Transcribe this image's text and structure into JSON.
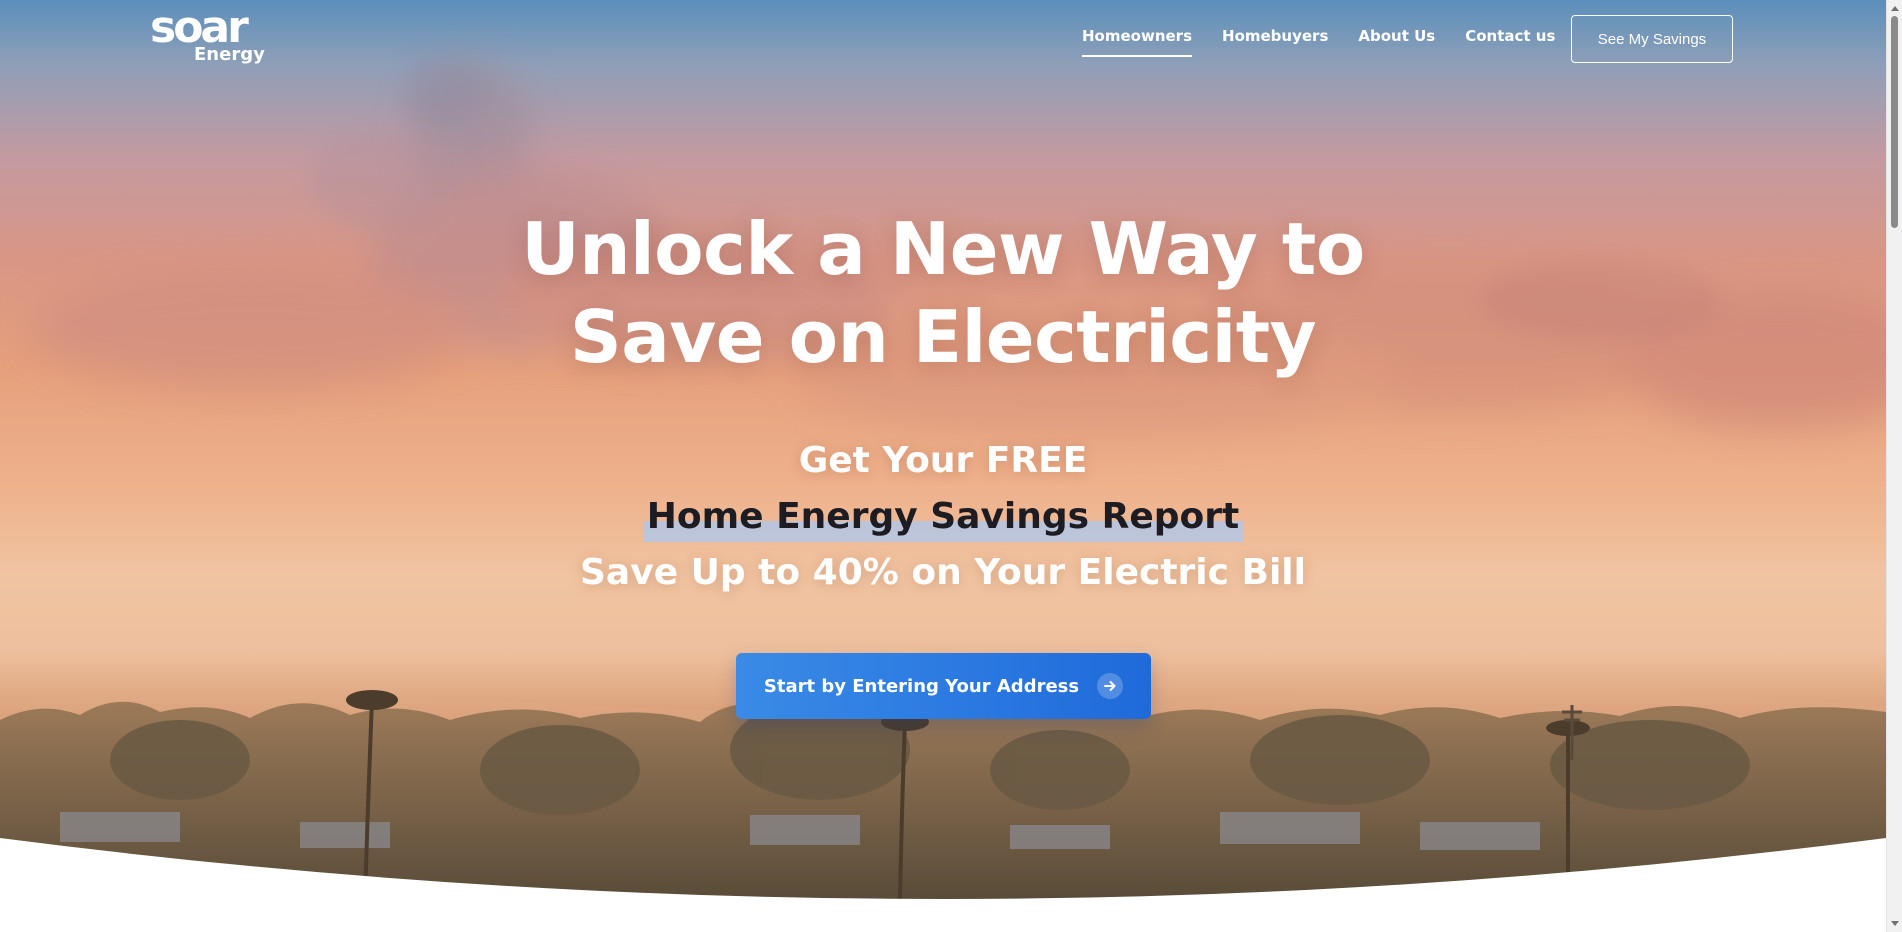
{
  "brand": {
    "logo_main": "soar",
    "logo_sub": "Energy"
  },
  "nav": {
    "items": [
      {
        "label": "Homeowners",
        "active": true
      },
      {
        "label": "Homebuyers",
        "active": false
      },
      {
        "label": "About Us",
        "active": false
      },
      {
        "label": "Contact us",
        "active": false
      }
    ],
    "cta_label": "See My Savings"
  },
  "hero": {
    "headline_line1": "Unlock a New Way to",
    "headline_line2": "Save on Electricity",
    "sub_line1": "Get Your FREE",
    "sub_line2": "Home Energy Savings Report",
    "sub_line3": "Save Up to 40% on Your Electric Bill",
    "cta_label": "Start by Entering Your Address",
    "cta_icon": "arrow-right-icon"
  },
  "colors": {
    "cta_blue": "#2c7be2",
    "text_white": "#ffffff",
    "highlight_text": "#1c1c22",
    "sky_top": "#5b8fbb",
    "sky_mid": "#e6a07c"
  }
}
